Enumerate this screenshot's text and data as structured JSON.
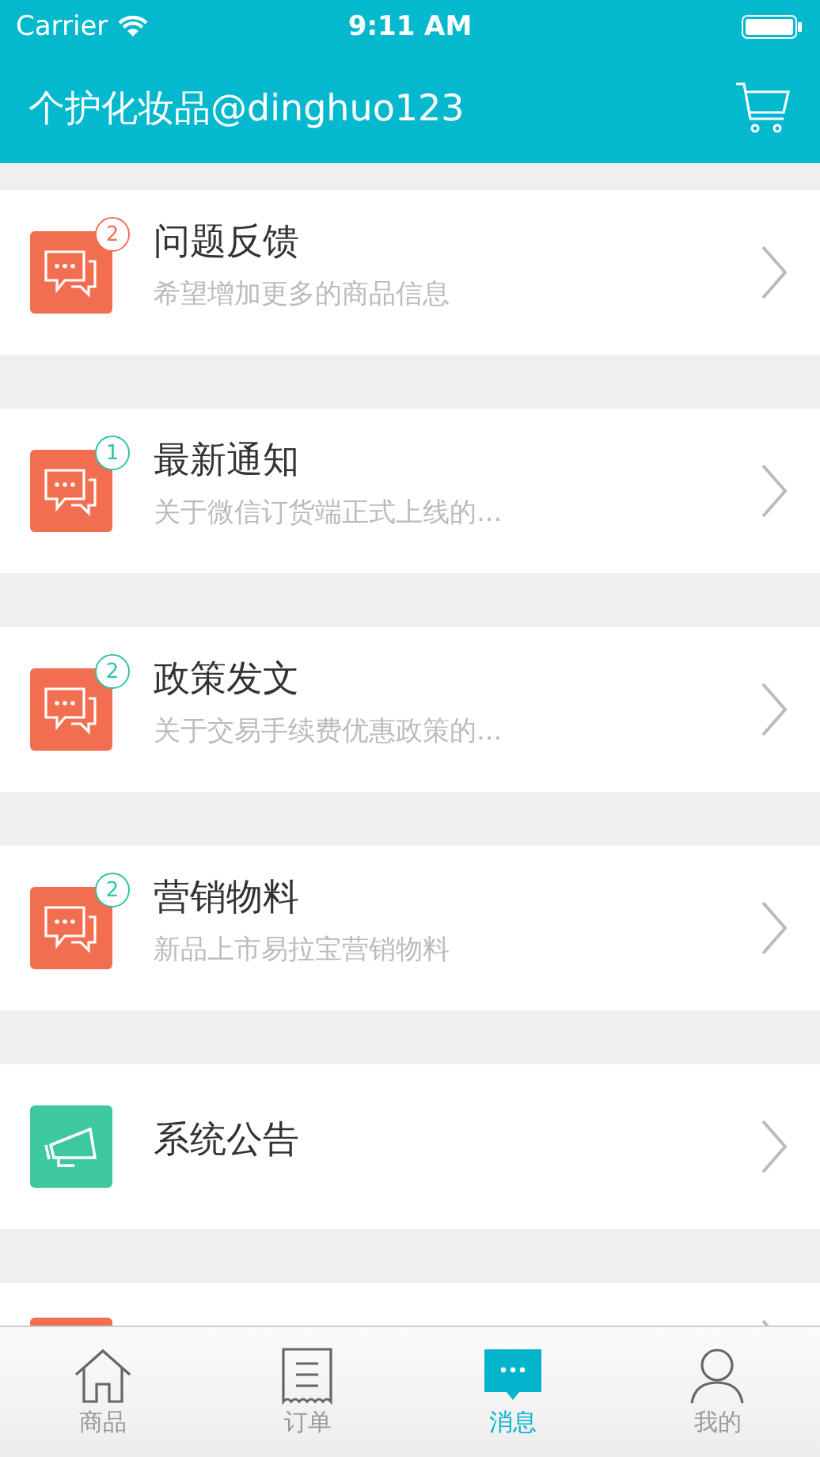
{
  "status_bar": {
    "carrier": "Carrier",
    "time": "9:11 AM"
  },
  "nav_bar": {
    "title": "个护化妆品@dinghuo123"
  },
  "messages": [
    {
      "kind": "chat",
      "title": "问题反馈",
      "subtitle": "希望增加更多的商品信息",
      "badge": {
        "count": "2",
        "color": "#f07050"
      }
    },
    {
      "kind": "chat",
      "title": "最新通知",
      "subtitle": "关于微信订货端正式上线的...",
      "badge": {
        "count": "1",
        "color": "#2ec4a0"
      }
    },
    {
      "kind": "chat",
      "title": "政策发文",
      "subtitle": "关于交易手续费优惠政策的...",
      "badge": {
        "count": "2",
        "color": "#2ec4a0"
      }
    },
    {
      "kind": "chat",
      "title": "营销物料",
      "subtitle": "新品上市易拉宝营销物料",
      "badge": {
        "count": "2",
        "color": "#2ec4a0"
      }
    },
    {
      "kind": "announce",
      "title": "系统公告"
    },
    {
      "kind": "chat"
    }
  ],
  "tab_bar": [
    {
      "kind": "home",
      "label": "商品",
      "selected": false
    },
    {
      "kind": "orders",
      "label": "订单",
      "selected": false
    },
    {
      "kind": "messages",
      "label": "消息",
      "selected": true
    },
    {
      "kind": "profile",
      "label": "我的",
      "selected": false
    }
  ]
}
